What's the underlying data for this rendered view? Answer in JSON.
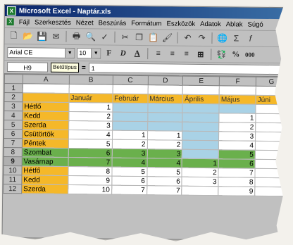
{
  "window": {
    "title": "Microsoft Excel - Naptár.xls"
  },
  "menu": [
    "Fájl",
    "Szerkesztés",
    "Nézet",
    "Beszúrás",
    "Formátum",
    "Eszközök",
    "Adatok",
    "Ablak",
    "Súgó"
  ],
  "toolbar": {
    "icons": [
      "new-icon",
      "open-icon",
      "save-icon",
      "mail-icon",
      "print-icon",
      "preview-icon",
      "spell-icon",
      "cut-icon",
      "copy-icon",
      "paste-icon",
      "format-painter-icon",
      "undo-icon",
      "redo-icon",
      "hyperlink-icon",
      "autosum-icon",
      "function-icon"
    ]
  },
  "format_bar": {
    "font": "Arial CE",
    "size": "10",
    "bold": "F",
    "italic": "D",
    "underline": "A",
    "percent": "%",
    "thousands": "000"
  },
  "formula_bar": {
    "name_box": "H9",
    "tooltip": "Betűtípus",
    "equals": "=",
    "value": "1"
  },
  "columns": [
    "A",
    "B",
    "C",
    "D",
    "E",
    "F",
    "G"
  ],
  "rows": [
    {
      "n": "1",
      "cells": [
        "",
        "",
        "",
        "",
        "",
        "",
        ""
      ]
    },
    {
      "n": "2",
      "cells": [
        "",
        "Január",
        "Február",
        "Március",
        "Április",
        "Május",
        "Júni"
      ]
    },
    {
      "n": "3",
      "cells": [
        "Hétfő",
        "1",
        "",
        "",
        "",
        "",
        ""
      ]
    },
    {
      "n": "4",
      "cells": [
        "Kedd",
        "2",
        "",
        "",
        "",
        "1",
        ""
      ]
    },
    {
      "n": "5",
      "cells": [
        "Szerda",
        "3",
        "",
        "",
        "",
        "2",
        ""
      ]
    },
    {
      "n": "6",
      "cells": [
        "Csütörtök",
        "4",
        "1",
        "1",
        "",
        "3",
        ""
      ]
    },
    {
      "n": "7",
      "cells": [
        "Péntek",
        "5",
        "2",
        "2",
        "",
        "4",
        ""
      ]
    },
    {
      "n": "8",
      "cells": [
        "Szombat",
        "6",
        "3",
        "3",
        "",
        "5",
        ""
      ]
    },
    {
      "n": "9",
      "cells": [
        "Vasárnap",
        "7",
        "4",
        "4",
        "1",
        "6",
        ""
      ]
    },
    {
      "n": "10",
      "cells": [
        "Hétfő",
        "8",
        "5",
        "5",
        "2",
        "7",
        ""
      ]
    },
    {
      "n": "11",
      "cells": [
        "Kedd",
        "9",
        "6",
        "6",
        "3",
        "8",
        ""
      ]
    },
    {
      "n": "12",
      "cells": [
        "Szerda",
        "10",
        "7",
        "7",
        "",
        "9",
        ""
      ]
    }
  ],
  "colors": {
    "weekday_yellow": "#f5b829",
    "blue_fill": "#a9d2e6",
    "weekend_green": "#6ab04c",
    "title_blue": "#0a246a"
  }
}
